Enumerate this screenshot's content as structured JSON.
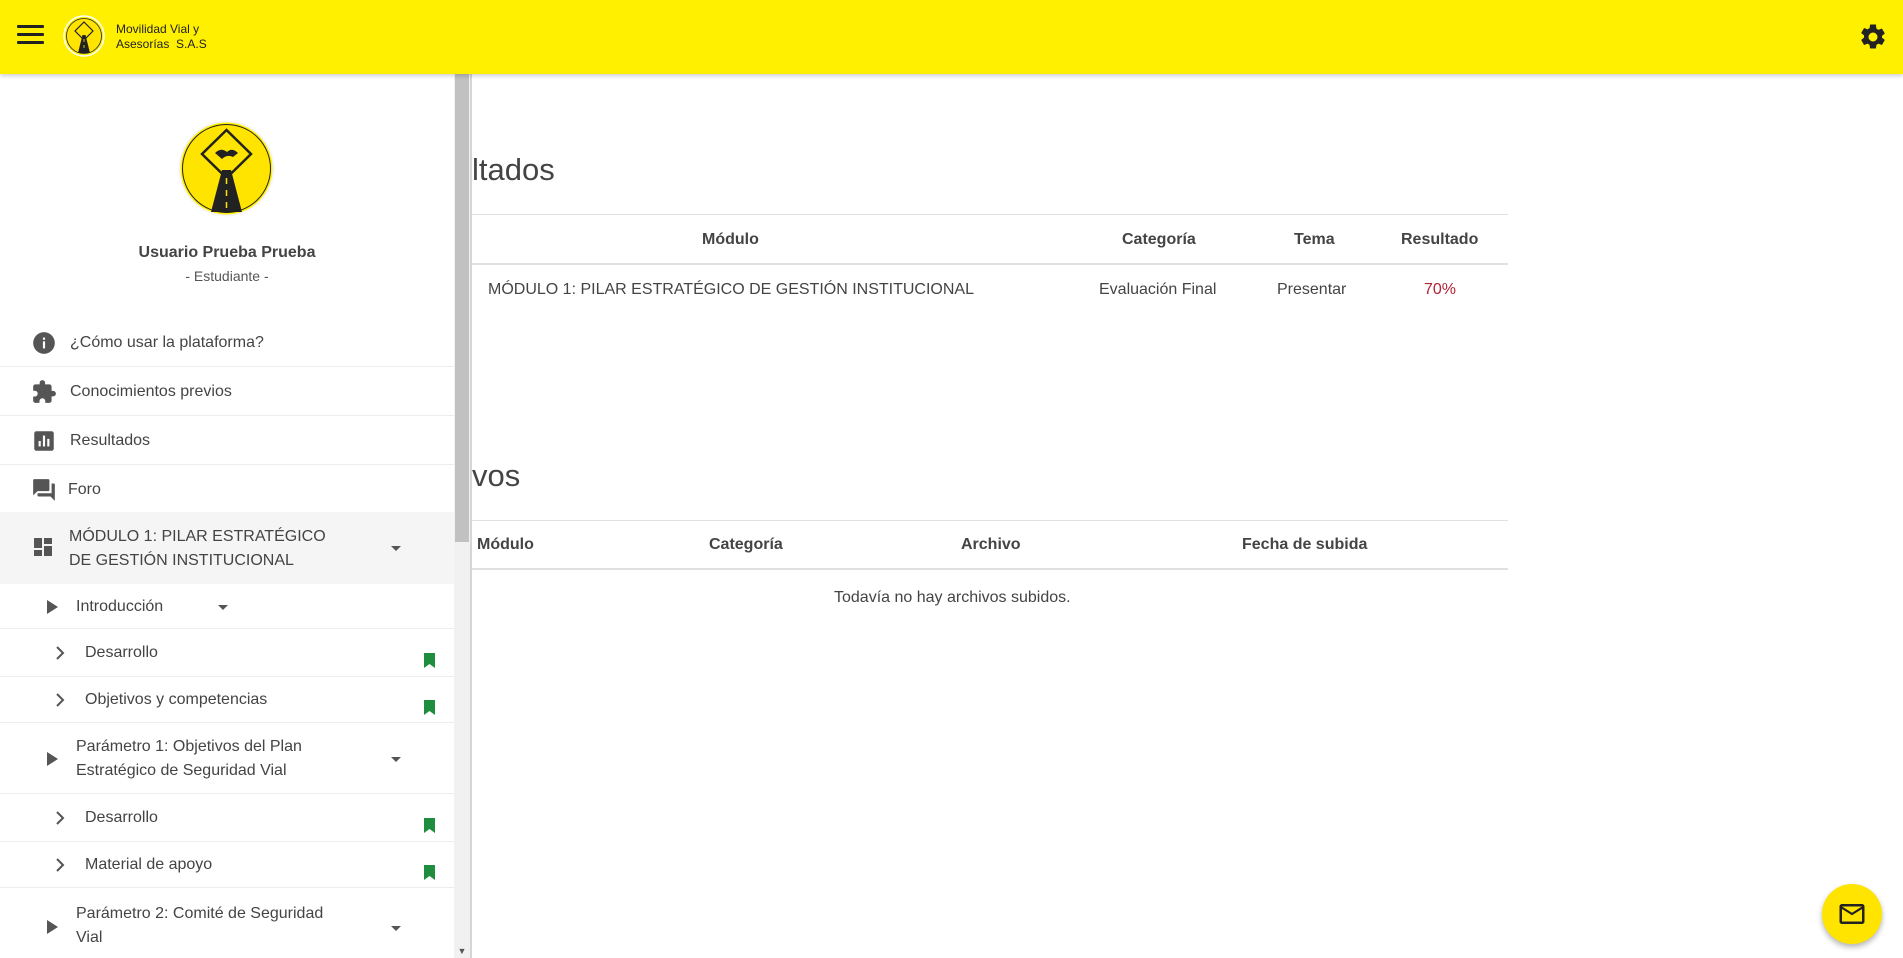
{
  "header": {
    "brand_line1": "Movilidad Vial y",
    "brand_line2": "Asesorías  S.A.S"
  },
  "sidebar": {
    "user_name": "Usuario Prueba Prueba",
    "user_role": "- Estudiante -",
    "nav": [
      {
        "label": "¿Cómo usar la plataforma?",
        "icon": "info-icon"
      },
      {
        "label": "Conocimientos previos",
        "icon": "puzzle-icon"
      },
      {
        "label": "Resultados",
        "icon": "bar-chart-icon"
      },
      {
        "label": "Foro",
        "icon": "forum-icon"
      }
    ],
    "module": {
      "line1": "MÓDULO 1: PILAR ESTRATÉGICO",
      "line2": "DE GESTIÓN INSTITUCIONAL",
      "icon": "dashboard-icon"
    },
    "sub_items": [
      {
        "label": "Introducción"
      },
      {
        "label": "Desarrollo"
      },
      {
        "label": "Objetivos y competencias"
      },
      {
        "line1": "Parámetro 1: Objetivos del Plan",
        "line2": "Estratégico de Seguridad Vial"
      },
      {
        "label": "Desarrollo"
      },
      {
        "label": "Material de apoyo"
      },
      {
        "line1": "Parámetro 2: Comité de Seguridad",
        "line2": "Vial"
      }
    ]
  },
  "results": {
    "title": "ltados",
    "headers": [
      "Módulo",
      "Categoría",
      "Tema",
      "Resultado"
    ],
    "rows": [
      {
        "modulo": "MÓDULO 1: PILAR ESTRATÉGICO DE GESTIÓN INSTITUCIONAL",
        "categoria": "Evaluación Final",
        "tema": "Presentar",
        "resultado": "70%"
      }
    ]
  },
  "files": {
    "title": "vos",
    "headers": [
      "Módulo",
      "Categoría",
      "Archivo",
      "Fecha de subida"
    ],
    "empty_message": "Todavía no hay archivos subidos."
  },
  "colors": {
    "topbar": "#FFF000",
    "fab": "#FFE400",
    "bookmark": "#1E8E3E",
    "percent": "#B22234"
  }
}
